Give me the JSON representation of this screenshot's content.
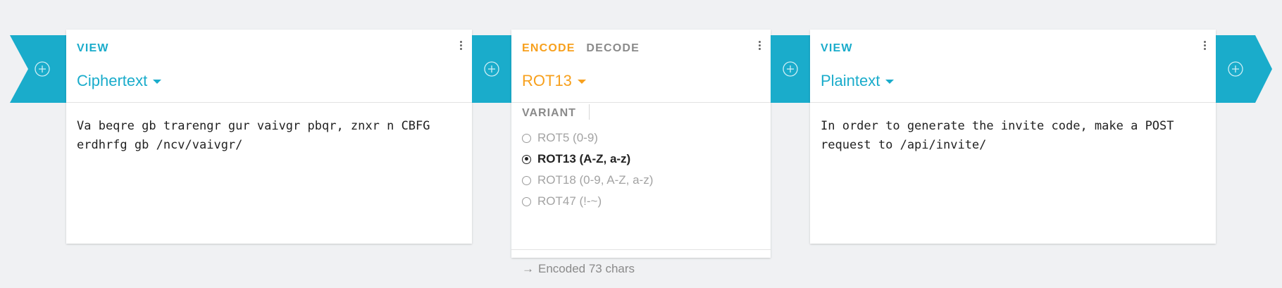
{
  "connectors": [
    {
      "icon": "add-circle-icon"
    },
    {
      "icon": "add-circle-icon"
    },
    {
      "icon": "add-circle-icon"
    },
    {
      "icon": "add-circle-icon"
    }
  ],
  "cards": {
    "ciphertext_view": {
      "tab_label": "VIEW",
      "selector_label": "Ciphertext",
      "content": "Va beqre gb trarengr gur vaivgr pbqr, znxr n CBFG erdhrfg gb /ncv/vaivgr/"
    },
    "rot13_encoder": {
      "tab_encode": "ENCODE",
      "tab_decode": "DECODE",
      "active_tab": "ENCODE",
      "selector_label": "ROT13",
      "variant_label": "VARIANT",
      "options": [
        {
          "label": "ROT5 (0-9)",
          "selected": false
        },
        {
          "label": "ROT13 (A-Z, a-z)",
          "selected": true
        },
        {
          "label": "ROT18 (0-9, A-Z, a-z)",
          "selected": false
        },
        {
          "label": "ROT47 (!-~)",
          "selected": false
        }
      ],
      "status": "Encoded 73 chars"
    },
    "plaintext_view": {
      "tab_label": "VIEW",
      "selector_label": "Plaintext",
      "content": "In order to generate the invite code, make a POST request to /api/invite/"
    }
  },
  "colors": {
    "accent_blue": "#1aaccb",
    "accent_orange": "#f7a01d",
    "background": "#f0f1f3"
  }
}
